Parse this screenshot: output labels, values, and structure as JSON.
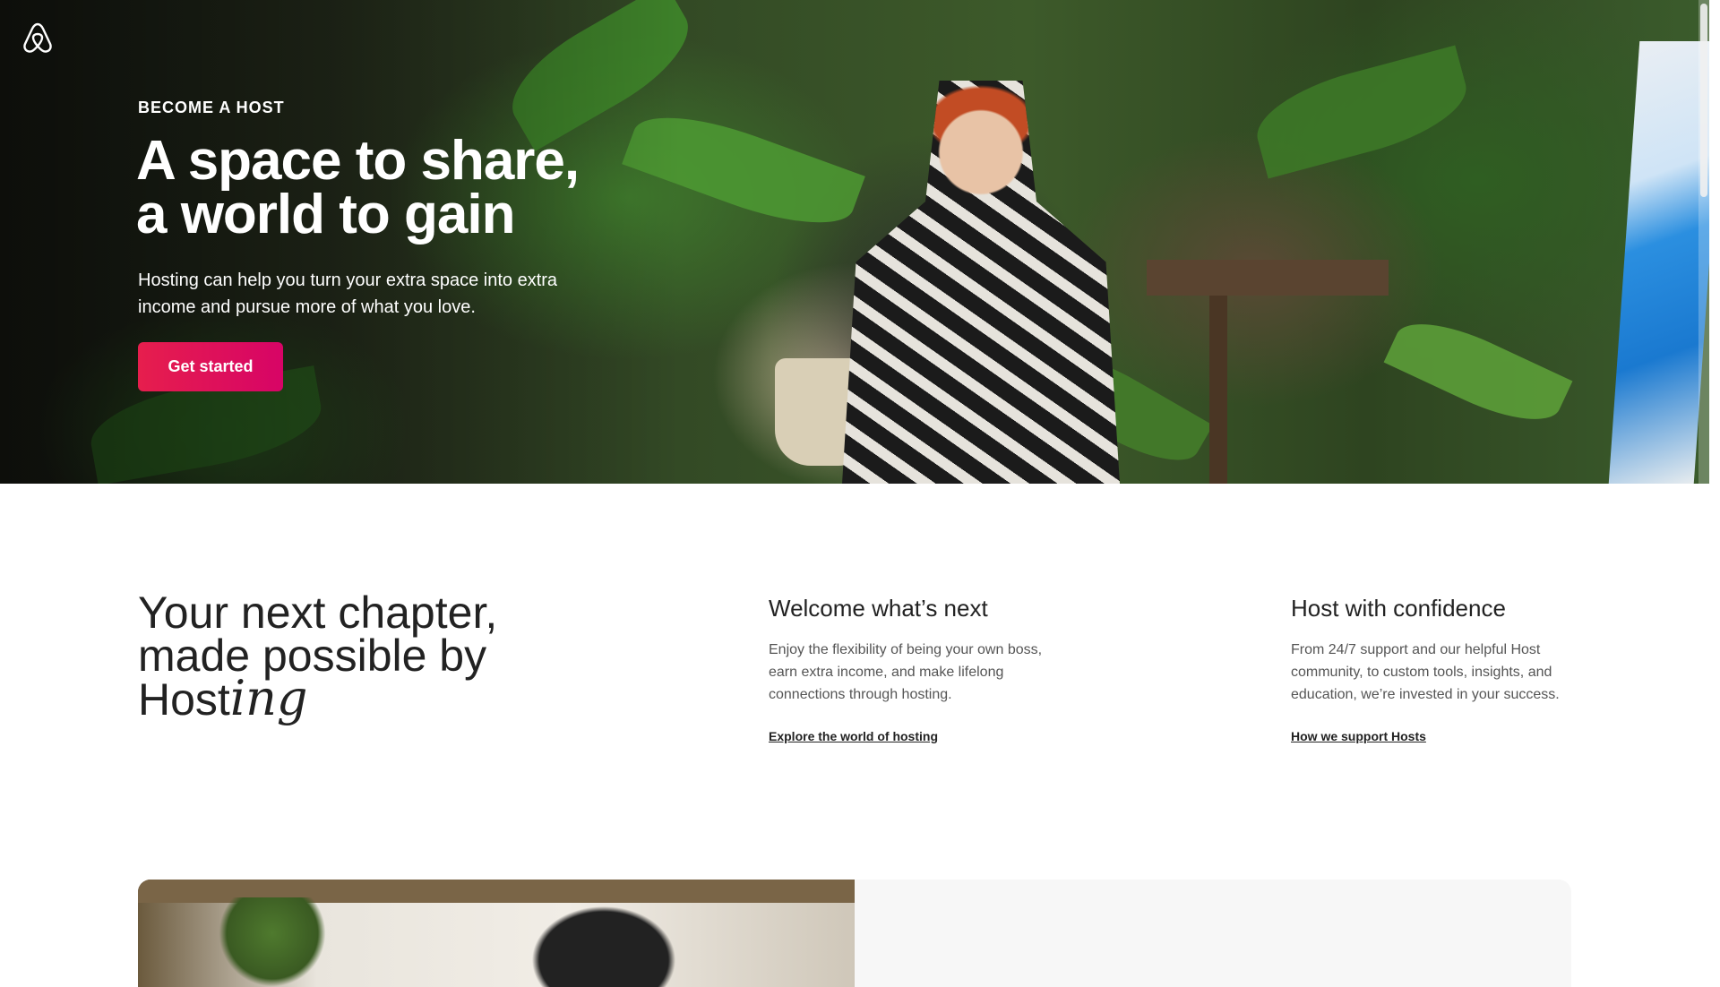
{
  "brand": {
    "logo_icon": "airbnb-logo-icon",
    "accent": "#E61E4D"
  },
  "hero": {
    "eyebrow": "BECOME A HOST",
    "title_line1": "A space to share,",
    "title_line2": "a world to gain",
    "subtitle": "Hosting can help you turn your extra space into extra income and pursue more of what you love.",
    "cta_label": "Get started"
  },
  "chapter": {
    "title_line1": "Your next chapter,",
    "title_line2": "made possible by",
    "title_word": "Host",
    "title_script": "ing"
  },
  "columns": [
    {
      "heading": "Welcome what’s next",
      "body": "Enjoy the flexibility of being your own boss, earn extra income, and make lifelong connections through hosting.",
      "link": "Explore the world of hosting"
    },
    {
      "heading": "Host with confidence",
      "body": "From 24/7 support and our helpful Host community, to custom tools, insights, and education, we’re invested in your success.",
      "link": "How we support Hosts"
    }
  ]
}
